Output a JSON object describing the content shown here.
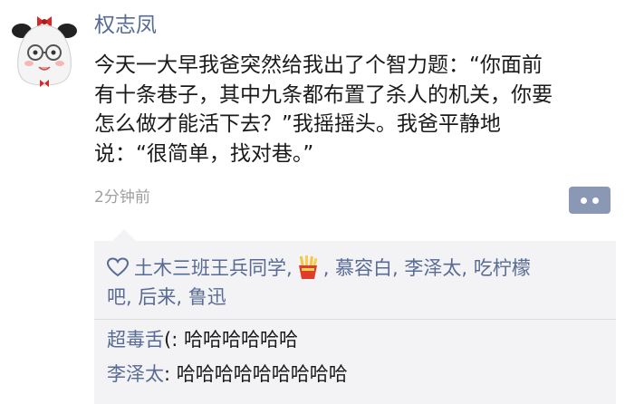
{
  "post": {
    "author": "权志凤",
    "text_lines": [
      "今天一大早我爸突然给我出了个智力题：“你面前",
      "有十条巷子，其中九条都布置了杀人的机关，你要",
      "怎么做才能活下去？”我摇摇头。我爸平静地",
      "说：“很简单，找对巷。”"
    ],
    "timestamp": "2分钟前"
  },
  "likes": {
    "line1_before": "土木三班王兵同学,",
    "line1_after": ", 慕容白, 李泽太, 吃柠檬",
    "line2": "吧, 后来, 鲁迅"
  },
  "comments": [
    {
      "name": "超毒舌",
      "text": "(: 哈哈哈哈哈哈"
    },
    {
      "name": "李泽太",
      "text": ": 哈哈哈哈哈哈哈哈哈"
    }
  ],
  "colors": {
    "link": "#576b95",
    "panel": "#f3f3f5",
    "more_button": "#8a98b5"
  },
  "icons": {
    "avatar": "rice-ball-bun-girl-avatar",
    "like": "heart-outline-icon",
    "liker_avatar": "french-fries-icon",
    "more": "more-dots-icon"
  }
}
